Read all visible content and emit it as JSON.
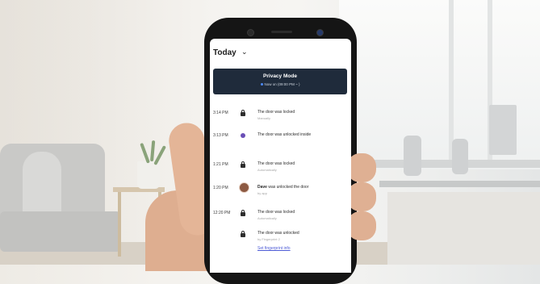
{
  "header": {
    "title": "Today"
  },
  "privacy_mode": {
    "title": "Privacy Mode",
    "status": "Now on (09:00 PM ~ )"
  },
  "events": [
    {
      "time": "3:14 PM",
      "icon": "lock-icon",
      "message": "The door was locked",
      "detail": "Manually"
    },
    {
      "time": "3:13 PM",
      "icon": "unlock-icon",
      "message": "The door was unlocked inside",
      "detail": ""
    },
    {
      "time": "1:21 PM",
      "icon": "lock-icon",
      "message": "The door was locked",
      "detail": "Automatically"
    },
    {
      "time": "1:20 PM",
      "icon": "avatar-icon",
      "user": "Dave",
      "message": " was unlocked the door",
      "detail": "by app"
    },
    {
      "time": "12:20 PM",
      "icon": "lock-icon",
      "message": "The door was locked",
      "detail": "Automatically"
    },
    {
      "time": "",
      "icon": "lock-icon",
      "message": "The door was unlocked",
      "detail": "by Fingerprint 2"
    }
  ],
  "link": "Set fingerprint info",
  "colors": {
    "privacy_banner": "#1f2b3b",
    "link": "#4d5bd6",
    "unlock_accent": "#6a4fb6"
  }
}
